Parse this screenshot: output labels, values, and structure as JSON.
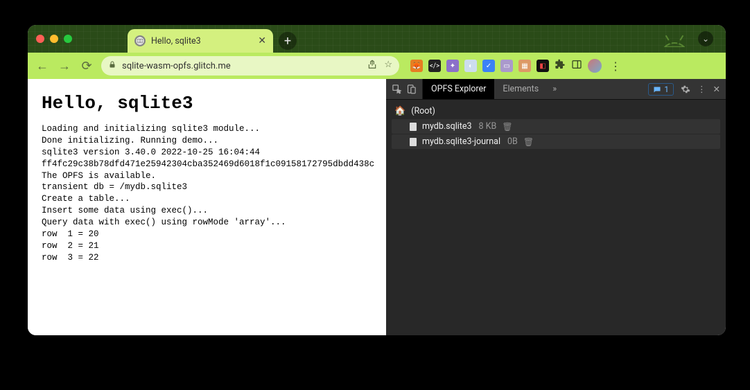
{
  "window": {
    "tab_title": "Hello, sqlite3",
    "url": "sqlite-wasm-opfs.glitch.me"
  },
  "page": {
    "heading": "Hello, sqlite3",
    "log_lines": [
      "Loading and initializing sqlite3 module...",
      "Done initializing. Running demo...",
      "sqlite3 version 3.40.0 2022-10-25 16:04:44",
      "ff4fc29c38b78dfd471e25942304cba352469d6018f1c09158172795dbdd438c",
      "The OPFS is available.",
      "transient db = /mydb.sqlite3",
      "Create a table...",
      "Insert some data using exec()...",
      "Query data with exec() using rowMode 'array'...",
      "row  1 = 20",
      "row  2 = 21",
      "row  3 = 22"
    ]
  },
  "devtools": {
    "tabs": {
      "active": "OPFS Explorer",
      "other": "Elements"
    },
    "issues_count": "1",
    "root_label": "(Root)",
    "files": [
      {
        "name": "mydb.sqlite3",
        "size": "8 KB"
      },
      {
        "name": "mydb.sqlite3-journal",
        "size": "0B"
      }
    ]
  }
}
